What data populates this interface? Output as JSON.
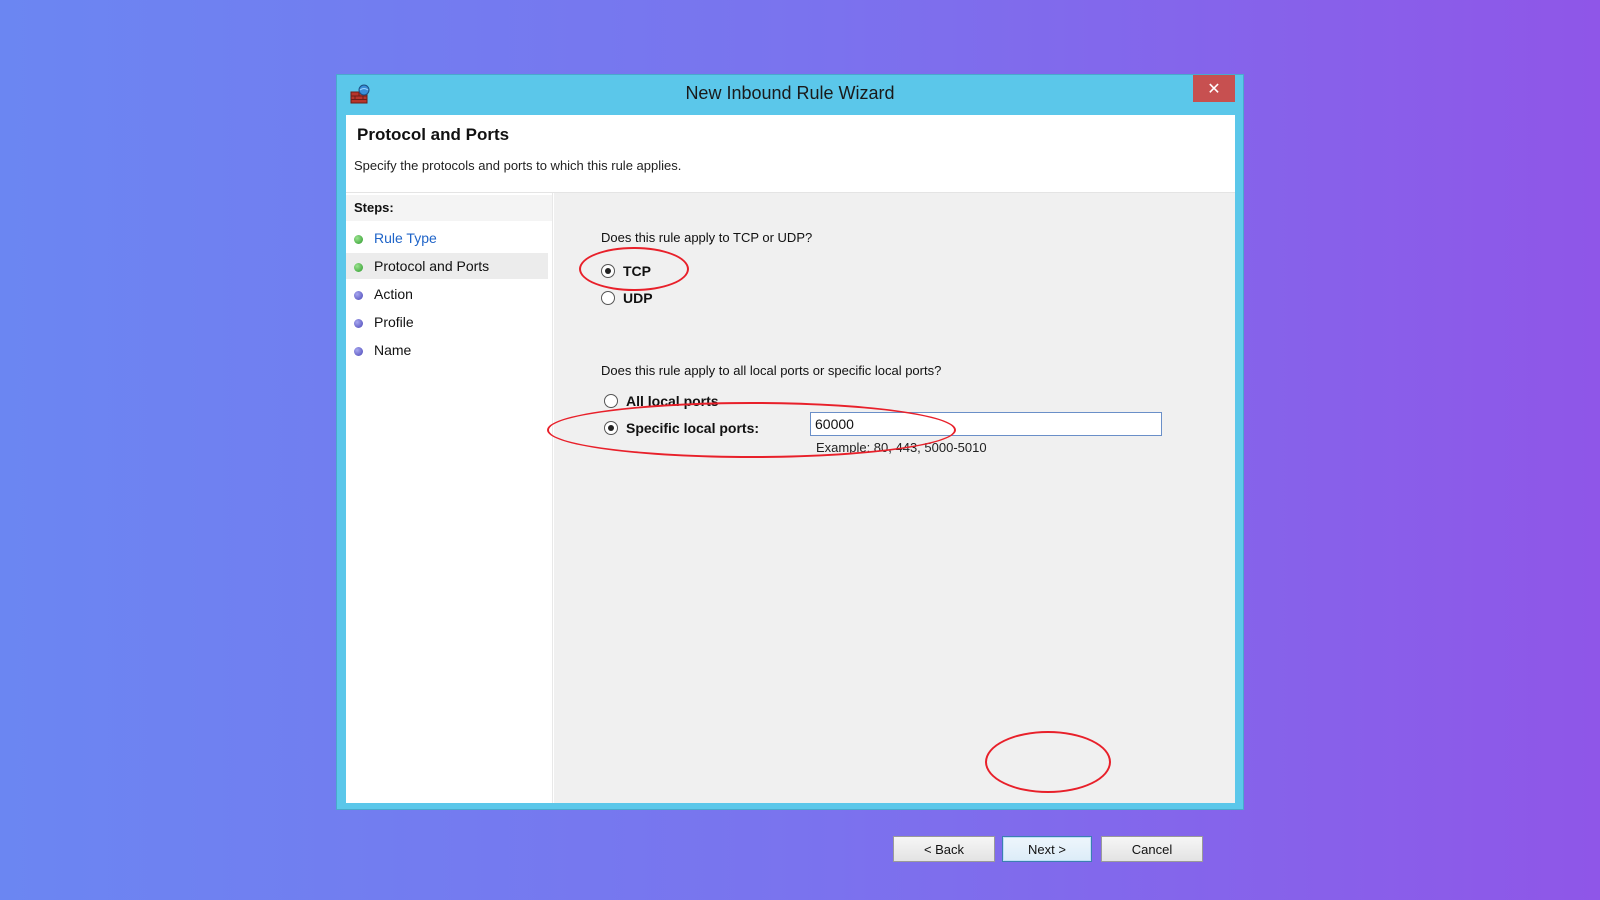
{
  "window": {
    "title": "New Inbound Rule Wizard",
    "close_label": "✕"
  },
  "header": {
    "title": "Protocol and Ports",
    "description": "Specify the protocols and ports to which this rule applies."
  },
  "steps": {
    "label": "Steps:",
    "items": [
      {
        "label": "Rule Type",
        "state": "link"
      },
      {
        "label": "Protocol and Ports",
        "state": "current"
      },
      {
        "label": "Action",
        "state": "pending"
      },
      {
        "label": "Profile",
        "state": "pending"
      },
      {
        "label": "Name",
        "state": "pending"
      }
    ]
  },
  "protocol": {
    "question": "Does this rule apply to TCP or UDP?",
    "options": [
      {
        "label": "TCP",
        "selected": true
      },
      {
        "label": "UDP",
        "selected": false
      }
    ]
  },
  "ports": {
    "question": "Does this rule apply to all local ports or specific local ports?",
    "all_label": "All local ports",
    "specific_label": "Specific local ports:",
    "value": "60000",
    "example": "Example: 80, 443, 5000-5010",
    "selected": "specific"
  },
  "buttons": {
    "back": "< Back",
    "next": "Next >",
    "cancel": "Cancel"
  },
  "colors": {
    "annotation": "#e8202a",
    "window_frame": "#5bc7ea",
    "close_button": "#c75050",
    "link": "#1f64c8"
  }
}
